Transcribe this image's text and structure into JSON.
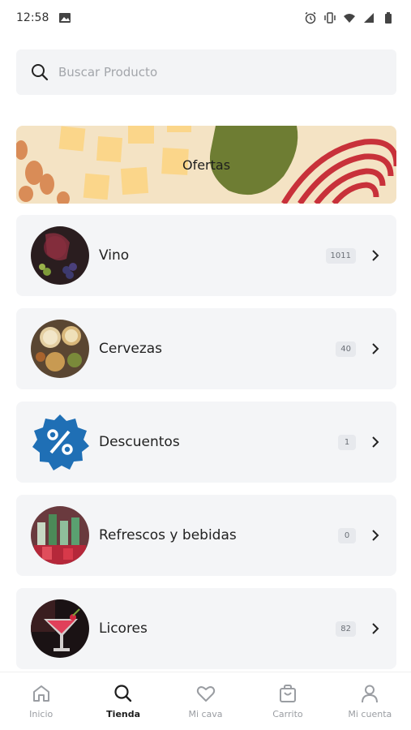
{
  "status_bar": {
    "time": "12:58"
  },
  "search": {
    "placeholder": "Buscar Producto",
    "value": ""
  },
  "banner": {
    "label": "Ofertas",
    "colors": {
      "background": "#f4e3c4",
      "squares": "#fbd68a",
      "leaf": "#6e7d33",
      "stripes": "#c8313a",
      "dots": "#d98c57"
    }
  },
  "categories": [
    {
      "label": "Vino",
      "count": "1011",
      "icon": "wine-image"
    },
    {
      "label": "Cervezas",
      "count": "40",
      "icon": "beer-image"
    },
    {
      "label": "Descuentos",
      "count": "1",
      "icon": "percent-badge-icon"
    },
    {
      "label": "Refrescos y bebidas",
      "count": "0",
      "icon": "soft-drinks-image"
    },
    {
      "label": "Licores",
      "count": "82",
      "icon": "cocktail-image"
    }
  ],
  "bottom_nav": {
    "items": [
      {
        "label": "Inicio",
        "icon": "home-icon",
        "active": false
      },
      {
        "label": "Tienda",
        "icon": "search-icon",
        "active": true
      },
      {
        "label": "Mi cava",
        "icon": "heart-icon",
        "active": false
      },
      {
        "label": "Carrito",
        "icon": "cart-icon",
        "active": false
      },
      {
        "label": "Mi cuenta",
        "icon": "user-icon",
        "active": false
      }
    ]
  },
  "colors": {
    "card_background": "#f4f5f7",
    "badge_background": "#e7e9ed",
    "discount_blue": "#1f6fb5"
  }
}
